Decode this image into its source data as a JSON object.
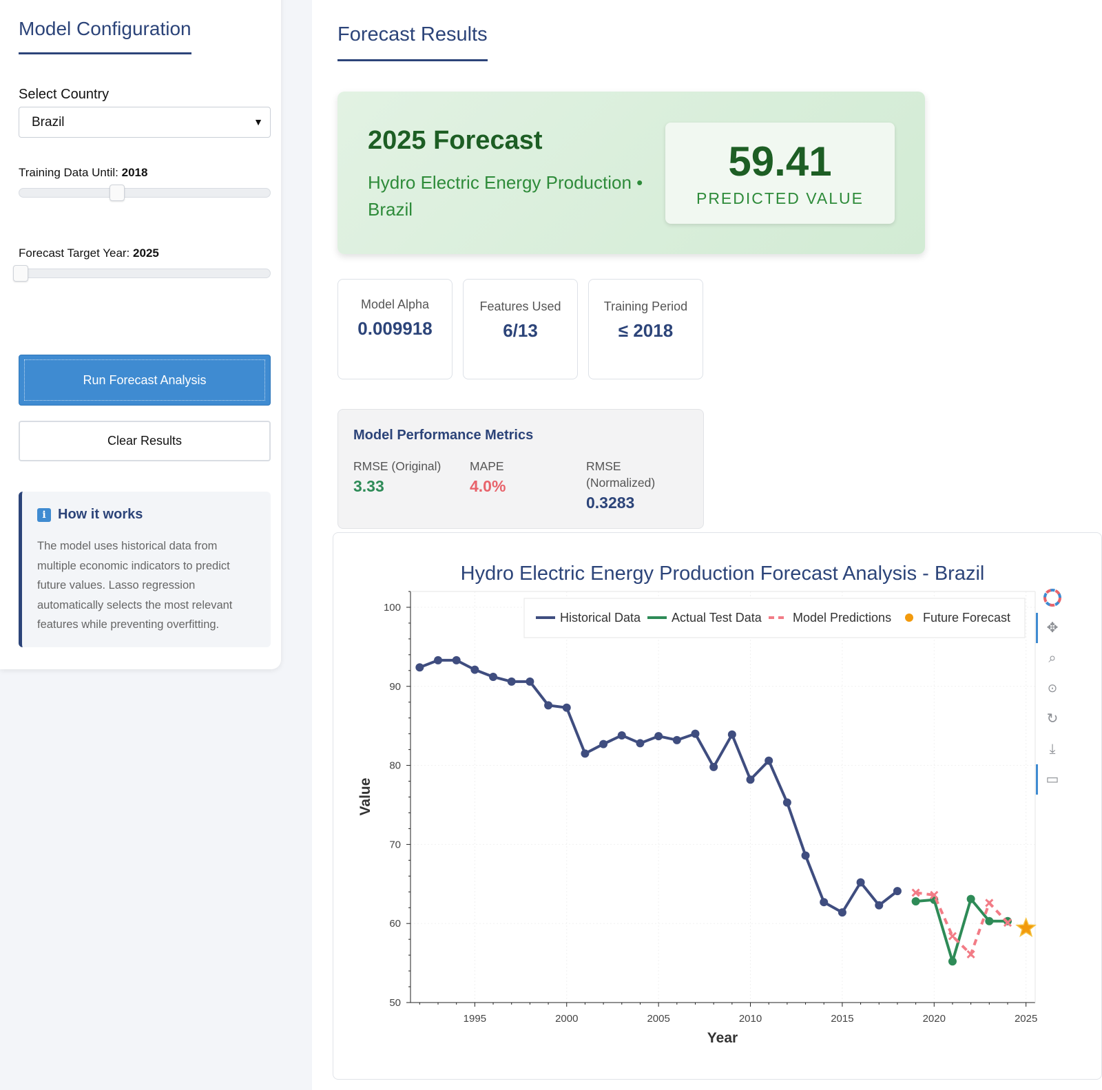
{
  "sidebar": {
    "title": "Model Configuration",
    "country_label": "Select Country",
    "country_value": "Brazil",
    "training_label": "Training Data Until:",
    "training_value": "2018",
    "training_fraction": 0.38,
    "target_label": "Forecast Target Year:",
    "target_value": "2025",
    "target_fraction": 0.0,
    "run_button": "Run Forecast Analysis",
    "clear_button": "Clear Results",
    "how_title": "How it works",
    "how_text": "The model uses historical data from multiple economic indicators to predict future values. Lasso regression automatically selects the most relevant features while preventing overfitting."
  },
  "main": {
    "title": "Forecast Results",
    "forecast": {
      "title": "2025 Forecast",
      "subtitle": "Hydro Electric Energy Production • Brazil",
      "value": "59.41",
      "value_label": "PREDICTED VALUE"
    },
    "stats": [
      {
        "label": "Model Alpha",
        "value": "0.009918"
      },
      {
        "label": "Features Used",
        "value": "6/13"
      },
      {
        "label": "Training Period",
        "value": "≤ 2018"
      }
    ],
    "performance": {
      "title": "Model Performance Metrics",
      "metrics": [
        {
          "label": "RMSE (Original)",
          "value": "3.33",
          "color": "#2e8b57"
        },
        {
          "label": "MAPE",
          "value": "4.0%",
          "color": "#e8636b"
        },
        {
          "label": "RMSE (Normalized)",
          "value": "0.3283",
          "color": "#2c4479"
        }
      ]
    }
  },
  "chart_data": {
    "type": "line",
    "title": "Hydro Electric Energy Production Forecast Analysis - Brazil",
    "xlabel": "Year",
    "ylabel": "Value",
    "xlim": [
      1991.5,
      2025.5
    ],
    "ylim": [
      50,
      102
    ],
    "xticks": [
      1995,
      2000,
      2005,
      2010,
      2015,
      2020,
      2025
    ],
    "yticks": [
      50,
      60,
      70,
      80,
      90,
      100
    ],
    "legend_position": "top-right",
    "series": [
      {
        "name": "Historical Data",
        "color": "#3f4d7f",
        "style": "solid-markers",
        "x": [
          1992,
          1993,
          1994,
          1995,
          1996,
          1997,
          1998,
          1999,
          2000,
          2001,
          2002,
          2003,
          2004,
          2005,
          2006,
          2007,
          2008,
          2009,
          2010,
          2011,
          2012,
          2013,
          2014,
          2015,
          2016,
          2017,
          2018
        ],
        "y": [
          92.4,
          93.3,
          93.3,
          92.1,
          91.2,
          90.6,
          90.6,
          87.6,
          87.3,
          81.5,
          82.7,
          83.8,
          82.8,
          83.7,
          83.2,
          84.0,
          79.8,
          83.9,
          78.2,
          80.6,
          75.3,
          68.6,
          62.7,
          61.4,
          65.2,
          62.3,
          64.1
        ]
      },
      {
        "name": "Actual Test Data",
        "color": "#2e8b57",
        "style": "solid-markers",
        "x": [
          2019,
          2020,
          2021,
          2022,
          2023,
          2024
        ],
        "y": [
          62.8,
          63.0,
          55.2,
          63.1,
          60.3,
          60.3
        ]
      },
      {
        "name": "Model Predictions",
        "color": "#f27c86",
        "style": "dashed-x",
        "x": [
          2019,
          2020,
          2021,
          2022,
          2023,
          2024
        ],
        "y": [
          63.9,
          63.6,
          58.4,
          56.1,
          62.6,
          60.1
        ]
      },
      {
        "name": "Future Forecast",
        "color": "#f29a0d",
        "style": "star",
        "x": [
          2025
        ],
        "y": [
          59.41
        ]
      }
    ]
  }
}
